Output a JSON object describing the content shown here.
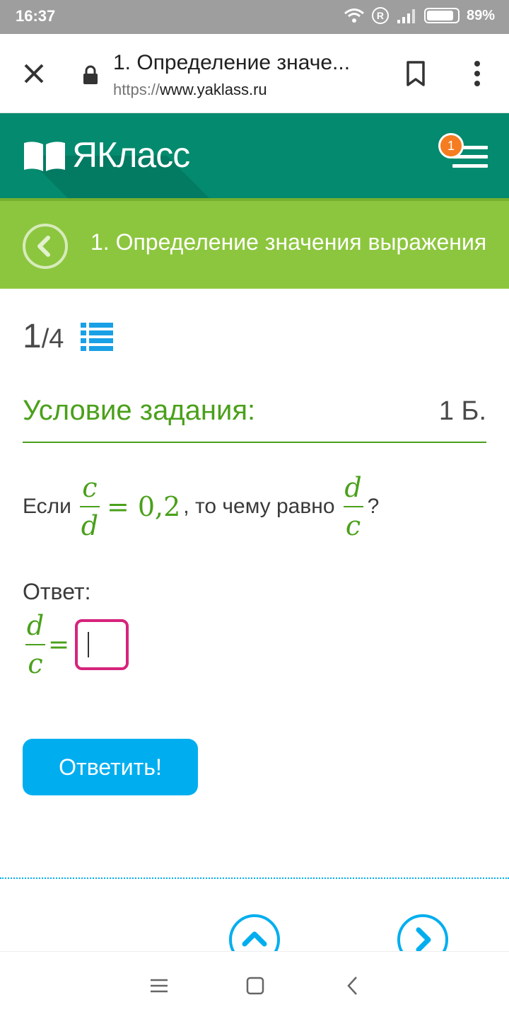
{
  "status_bar": {
    "time": "16:37",
    "battery_percent": "89%",
    "battery_level": 0.89,
    "icons": [
      "wifi-icon",
      "registered-icon",
      "signal-icon",
      "battery-icon"
    ]
  },
  "browser": {
    "page_title": "1. Определение значе...",
    "url_scheme": "https://",
    "url_host": "www.yaklass.ru",
    "icons": [
      "close-icon",
      "lock-icon",
      "bookmark-icon",
      "more-vert-icon"
    ]
  },
  "site_header": {
    "brand": "ЯКласс",
    "notification_count": "1",
    "colors": {
      "header_bg": "#048a6e",
      "badge": "#f57c20"
    }
  },
  "topic_bar": {
    "title": "1. Определение значения выражения",
    "color": "#8cc63e"
  },
  "task": {
    "progress_current": "1",
    "progress_total": "/4",
    "condition_title": "Условие задания:",
    "points": "1 Б.",
    "question_prefix": "Если",
    "frac1_num": "c",
    "frac1_den": "d",
    "equals_value": "= 0,2",
    "question_middle": ", то чему равно",
    "frac2_num": "d",
    "frac2_den": "c",
    "question_suffix": "?",
    "answer_label": "Ответ:",
    "answer_frac_num": "d",
    "answer_frac_den": "c",
    "answer_eq": "=",
    "answer_value": "",
    "submit_label": "Ответить!",
    "colors": {
      "accent_green": "#4aa01a",
      "input_border": "#d6247c",
      "button": "#00aeef"
    }
  },
  "system_nav": {
    "icons": [
      "recents-icon",
      "home-icon",
      "back-icon"
    ]
  }
}
